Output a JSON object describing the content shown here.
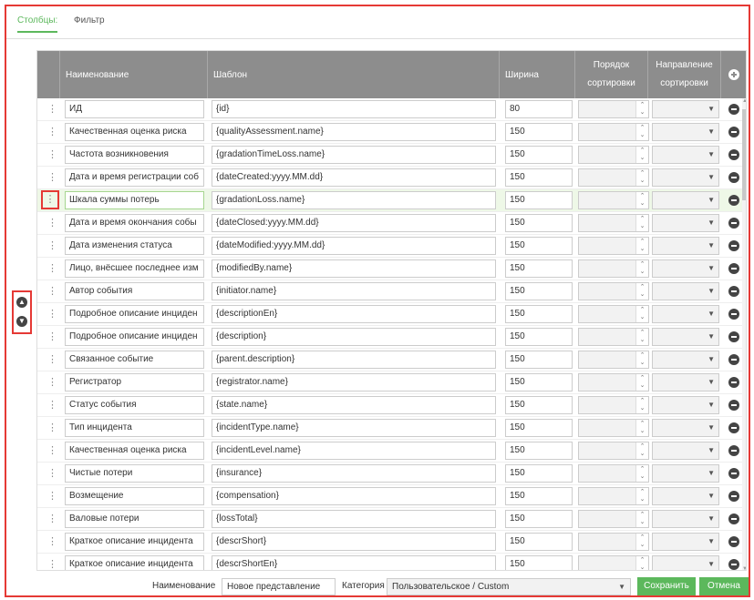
{
  "tabs": {
    "columns": "Столбцы:",
    "filter": "Фильтр"
  },
  "header": {
    "name": "Наименование",
    "template": "Шаблон",
    "width": "Ширина",
    "sort_order_line1": "Порядок",
    "sort_order_line2": "сортировки",
    "sort_dir_line1": "Направление",
    "sort_dir_line2": "сортировки"
  },
  "rows": [
    {
      "name": "ИД",
      "template": "{id}",
      "width": "80"
    },
    {
      "name": "Качественная оценка риска",
      "template": "{qualityAssessment.name}",
      "width": "150"
    },
    {
      "name": "Частота возникновения",
      "template": "{gradationTimeLoss.name}",
      "width": "150"
    },
    {
      "name": "Дата и время регистрации соб",
      "template": "{dateCreated:yyyy.MM.dd}",
      "width": "150"
    },
    {
      "name": "Шкала суммы потерь",
      "template": "{gradationLoss.name}",
      "width": "150"
    },
    {
      "name": "Дата и время окончания собы",
      "template": "{dateClosed:yyyy.MM.dd}",
      "width": "150"
    },
    {
      "name": "Дата изменения статуса",
      "template": "{dateModified:yyyy.MM.dd}",
      "width": "150"
    },
    {
      "name": "Лицо, внёсшее последнее изм",
      "template": "{modifiedBy.name}",
      "width": "150"
    },
    {
      "name": "Автор события",
      "template": "{initiator.name}",
      "width": "150"
    },
    {
      "name": "Подробное описание инциден",
      "template": "{descriptionEn}",
      "width": "150"
    },
    {
      "name": "Подробное описание инциден",
      "template": "{description}",
      "width": "150"
    },
    {
      "name": "Связанное событие",
      "template": "{parent.description}",
      "width": "150"
    },
    {
      "name": "Регистратор",
      "template": "{registrator.name}",
      "width": "150"
    },
    {
      "name": "Статус события",
      "template": "{state.name}",
      "width": "150"
    },
    {
      "name": "Тип инцидента",
      "template": "{incidentType.name}",
      "width": "150"
    },
    {
      "name": "Качественная оценка риска",
      "template": "{incidentLevel.name}",
      "width": "150"
    },
    {
      "name": "Чистые потери",
      "template": "{insurance}",
      "width": "150"
    },
    {
      "name": "Возмещение",
      "template": "{compensation}",
      "width": "150"
    },
    {
      "name": "Валовые потери",
      "template": "{lossTotal}",
      "width": "150"
    },
    {
      "name": "Краткое описание инцидента",
      "template": "{descrShort}",
      "width": "150"
    },
    {
      "name": "Краткое описание инцидента",
      "template": "{descrShortEn}",
      "width": "150"
    }
  ],
  "footer": {
    "name_label": "Наименование",
    "name_value": "Новое представление",
    "category_label": "Категория",
    "category_value": "Пользовательское / Custom",
    "save": "Сохранить",
    "cancel": "Отмена"
  },
  "icons": {
    "drag": "drag-handle-icon",
    "remove": "minus-circle-icon",
    "add": "plus-circle-icon",
    "move_up": "arrow-up-circle-icon",
    "move_down": "arrow-down-circle-icon"
  },
  "colors": {
    "accent": "#5cb85c",
    "header_bg": "#8d8d8d",
    "highlight": "#e53935",
    "selected_row": "#eef8e7"
  }
}
